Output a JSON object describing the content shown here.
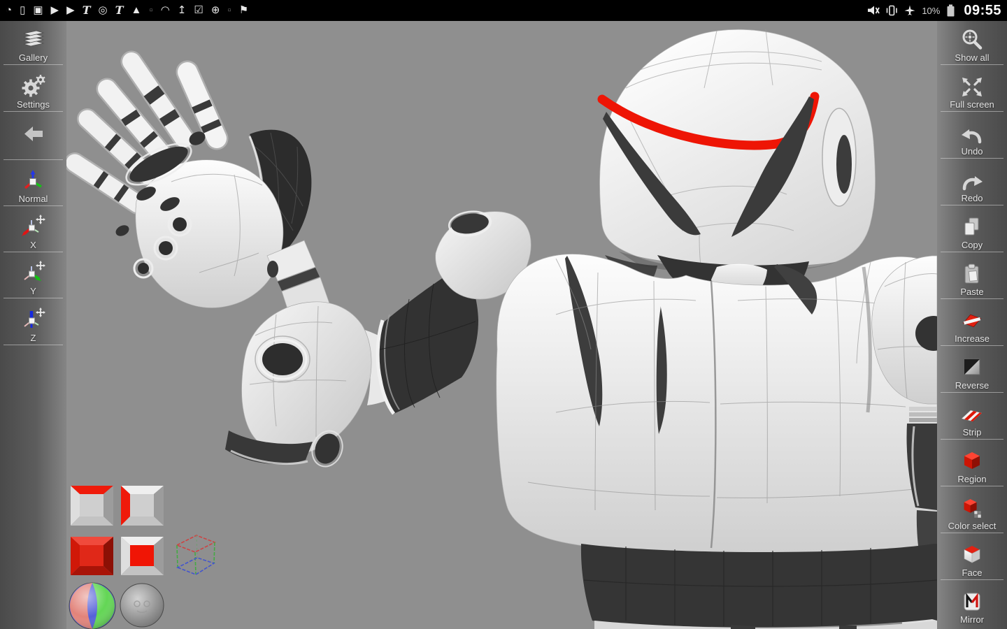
{
  "status_bar": {
    "time": "09:55",
    "battery_percent": "10%",
    "notification_icons": [
      {
        "name": "clock-icon",
        "glyph": "◔"
      },
      {
        "name": "phone-icon",
        "glyph": "▯"
      },
      {
        "name": "screenshot-icon",
        "glyph": "▣"
      },
      {
        "name": "video-icon",
        "glyph": "▶"
      },
      {
        "name": "video-icon-2",
        "glyph": "▶"
      },
      {
        "name": "news-icon",
        "glyph": "T"
      },
      {
        "name": "record-icon",
        "glyph": "◎"
      },
      {
        "name": "news-icon-2",
        "glyph": "T"
      },
      {
        "name": "warning-icon",
        "glyph": "▲"
      },
      {
        "name": "app-icon-dim",
        "glyph": "▫"
      },
      {
        "name": "wifi-icon",
        "glyph": "◠"
      },
      {
        "name": "upload-icon",
        "glyph": "↥"
      },
      {
        "name": "task-done-icon",
        "glyph": "☑"
      },
      {
        "name": "target-icon",
        "glyph": "⊕"
      },
      {
        "name": "app-icon-dim-2",
        "glyph": "▫"
      },
      {
        "name": "flag-icon",
        "glyph": "⚑"
      }
    ],
    "system_icons": [
      "mute-icon",
      "vibrate-icon",
      "airplane-icon",
      "battery-icon"
    ]
  },
  "left_toolbar": {
    "items": [
      {
        "label": "Gallery",
        "icon": "gallery-icon"
      },
      {
        "label": "Settings",
        "icon": "settings-icon"
      },
      {
        "label": "",
        "icon": "back-arrow-icon"
      },
      {
        "label": "Normal",
        "icon": "axis-normal-icon"
      },
      {
        "label": "X",
        "icon": "axis-x-icon"
      },
      {
        "label": "Y",
        "icon": "axis-y-icon"
      },
      {
        "label": "Z",
        "icon": "axis-z-icon"
      }
    ]
  },
  "right_toolbar": {
    "items": [
      {
        "label": "Show all",
        "icon": "zoom-all-icon"
      },
      {
        "label": "Full screen",
        "icon": "fullscreen-icon"
      },
      {
        "label": "Undo",
        "icon": "undo-icon"
      },
      {
        "label": "Redo",
        "icon": "redo-icon"
      },
      {
        "label": "Copy",
        "icon": "copy-icon"
      },
      {
        "label": "Paste",
        "icon": "paste-icon"
      },
      {
        "label": "Increase",
        "icon": "increase-icon"
      },
      {
        "label": "Reverse",
        "icon": "reverse-icon"
      },
      {
        "label": "Strip",
        "icon": "strip-icon"
      },
      {
        "label": "Region",
        "icon": "region-icon"
      },
      {
        "label": "Color select",
        "icon": "color-select-icon"
      },
      {
        "label": "Face",
        "icon": "face-icon"
      },
      {
        "label": "Mirror",
        "icon": "mirror-icon"
      }
    ]
  },
  "view_controls": {
    "buttons": [
      {
        "name": "box-top-red-button"
      },
      {
        "name": "box-side-red-button"
      },
      {
        "name": "box-solid-red-button"
      },
      {
        "name": "box-center-red-button"
      },
      {
        "name": "wire-cube-button"
      },
      {
        "name": "rgb-sphere-button"
      },
      {
        "name": "gray-sphere-button"
      }
    ]
  },
  "colors": {
    "accent_red": "#ee1505",
    "viewport_bg": "#8f8f8f",
    "toolbar_dark": "#4a4a4a",
    "model_dark": "#3a3a3a"
  }
}
